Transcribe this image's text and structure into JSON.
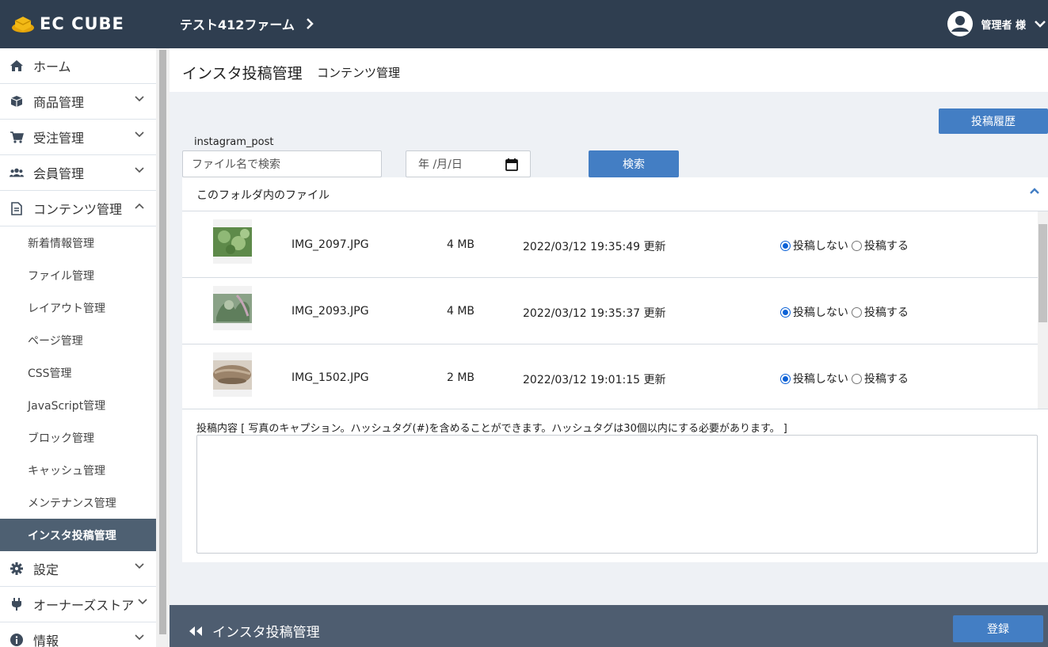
{
  "header": {
    "logo_text": "EC CUBE",
    "shop_name": "テスト412ファーム",
    "user_name": "管理者 様"
  },
  "sidebar": {
    "items": [
      {
        "label": "ホーム",
        "icon": "home-icon"
      },
      {
        "label": "商品管理",
        "icon": "box-icon"
      },
      {
        "label": "受注管理",
        "icon": "cart-icon"
      },
      {
        "label": "会員管理",
        "icon": "users-icon"
      },
      {
        "label": "コンテンツ管理",
        "icon": "document-icon"
      }
    ],
    "sub_items": [
      "新着情報管理",
      "ファイル管理",
      "レイアウト管理",
      "ページ管理",
      "CSS管理",
      "JavaScript管理",
      "ブロック管理",
      "キャッシュ管理",
      "メンテナンス管理",
      "インスタ投稿管理"
    ],
    "active_sub": "インスタ投稿管理",
    "bottom_items": [
      {
        "label": "設定",
        "icon": "gear-icon"
      },
      {
        "label": "オーナーズストア",
        "icon": "plug-icon"
      },
      {
        "label": "情報",
        "icon": "info-icon"
      }
    ]
  },
  "page": {
    "title": "インスタ投稿管理",
    "subtitle": "コンテンツ管理"
  },
  "toolbar": {
    "history_label": "投稿履歴",
    "folder_label": "instagram_post",
    "file_search_placeholder": "ファイル名で検索",
    "date_placeholder": "年 /月/日",
    "search_label": "検索"
  },
  "file_panel": {
    "title": "このフォルダ内のファイル",
    "rows": [
      {
        "name": "IMG_2097.JPG",
        "size": "4 MB",
        "date": "2022/03/12 19:35:49 更新",
        "opt_no": "投稿しない",
        "opt_yes": "投稿する",
        "selected": "no",
        "thumb_color": "#6f9a5a"
      },
      {
        "name": "IMG_2093.JPG",
        "size": "4 MB",
        "date": "2022/03/12 19:35:37 更新",
        "opt_no": "投稿しない",
        "opt_yes": "投稿する",
        "selected": "no",
        "thumb_color": "#7c9a6e"
      },
      {
        "name": "IMG_1502.JPG",
        "size": "2 MB",
        "date": "2022/03/12 19:01:15 更新",
        "opt_no": "投稿しない",
        "opt_yes": "投稿する",
        "selected": "no",
        "thumb_color": "#a08a72"
      }
    ]
  },
  "caption": {
    "label": "投稿内容 [ 写真のキャプション。ハッシュタグ(#)を含めることができます。ハッシュタグは30個以内にする必要があります。 ]",
    "value": ""
  },
  "footer": {
    "back_label": "インスタ投稿管理",
    "register_label": "登録"
  },
  "colors": {
    "header_bg": "#2f3e50",
    "accent": "#437ec4",
    "footer_bg": "#4e5d70",
    "active_nav": "#4e6072"
  }
}
